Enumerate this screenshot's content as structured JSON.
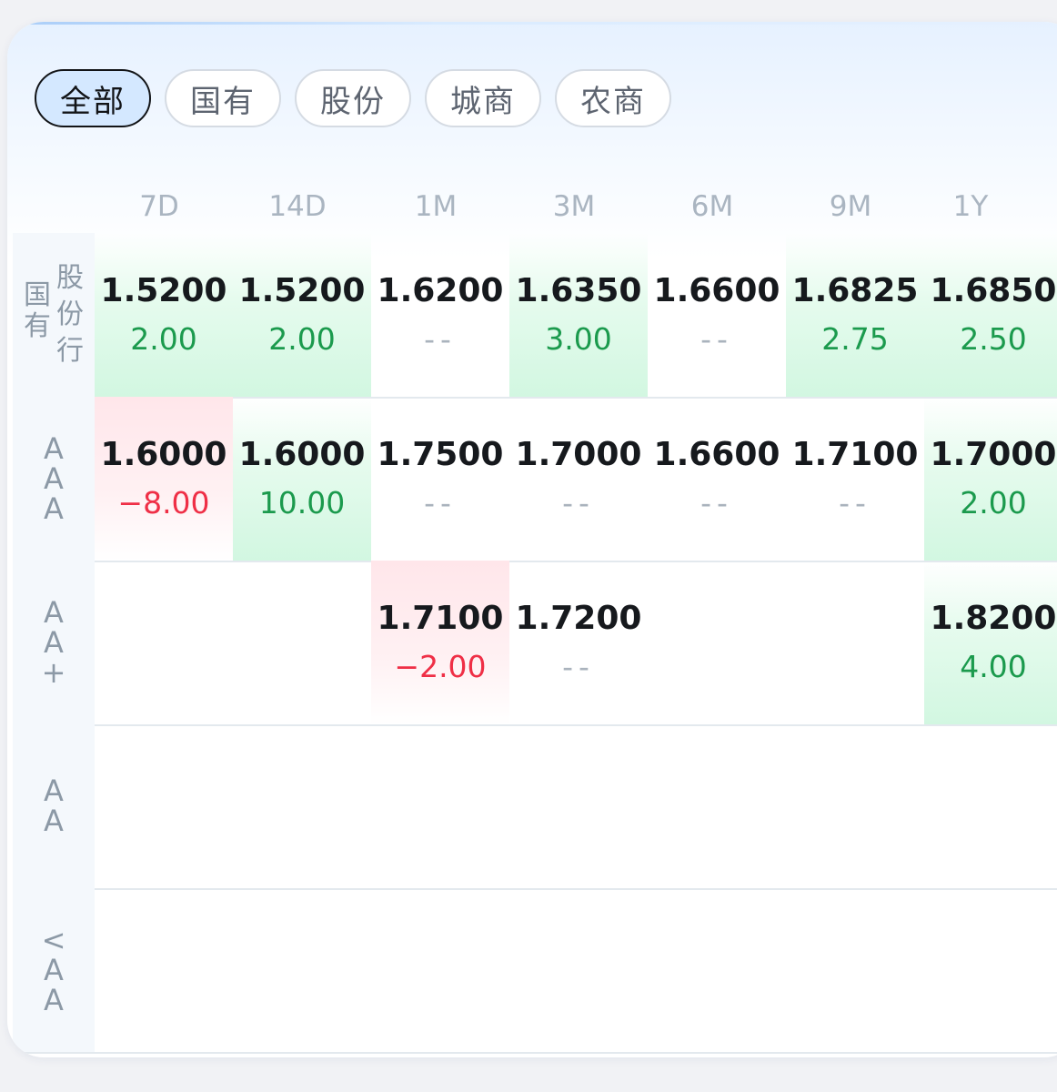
{
  "tabs": [
    {
      "label": "全部",
      "active": true
    },
    {
      "label": "国有",
      "active": false
    },
    {
      "label": "股份",
      "active": false
    },
    {
      "label": "城商",
      "active": false
    },
    {
      "label": "农商",
      "active": false
    }
  ],
  "columns": [
    "7D",
    "14D",
    "1M",
    "3M",
    "6M",
    "9M",
    "1Y"
  ],
  "rows": [
    {
      "label_col_a": "国有",
      "label_col_b": "股份行",
      "cells": [
        {
          "value": "1.5200",
          "change": "2.00",
          "trend": "up"
        },
        {
          "value": "1.5200",
          "change": "2.00",
          "trend": "up"
        },
        {
          "value": "1.6200",
          "change": "--",
          "trend": "none"
        },
        {
          "value": "1.6350",
          "change": "3.00",
          "trend": "up"
        },
        {
          "value": "1.6600",
          "change": "--",
          "trend": "none"
        },
        {
          "value": "1.6825",
          "change": "2.75",
          "trend": "up"
        },
        {
          "value": "1.6850",
          "change": "2.50",
          "trend": "up"
        }
      ]
    },
    {
      "label": "AAA",
      "cells": [
        {
          "value": "1.6000",
          "change": "−8.00",
          "trend": "down"
        },
        {
          "value": "1.6000",
          "change": "10.00",
          "trend": "up"
        },
        {
          "value": "1.7500",
          "change": "--",
          "trend": "none"
        },
        {
          "value": "1.7000",
          "change": "--",
          "trend": "none"
        },
        {
          "value": "1.6600",
          "change": "--",
          "trend": "none"
        },
        {
          "value": "1.7100",
          "change": "--",
          "trend": "none"
        },
        {
          "value": "1.7000",
          "change": "2.00",
          "trend": "up"
        }
      ]
    },
    {
      "label": "AA+",
      "cells": [
        null,
        null,
        {
          "value": "1.7100",
          "change": "−2.00",
          "trend": "down"
        },
        {
          "value": "1.7200",
          "change": "--",
          "trend": "none"
        },
        null,
        null,
        {
          "value": "1.8200",
          "change": "4.00",
          "trend": "up"
        }
      ]
    },
    {
      "label": "AA",
      "cells": [
        null,
        null,
        null,
        null,
        null,
        null,
        null
      ]
    },
    {
      "label": "<AA",
      "cells": [
        null,
        null,
        null,
        null,
        null,
        null,
        null
      ]
    }
  ],
  "colors": {
    "up": "#1b9a4d",
    "down": "#ef2f46",
    "active_tab_bg": "#d4e8ff"
  }
}
